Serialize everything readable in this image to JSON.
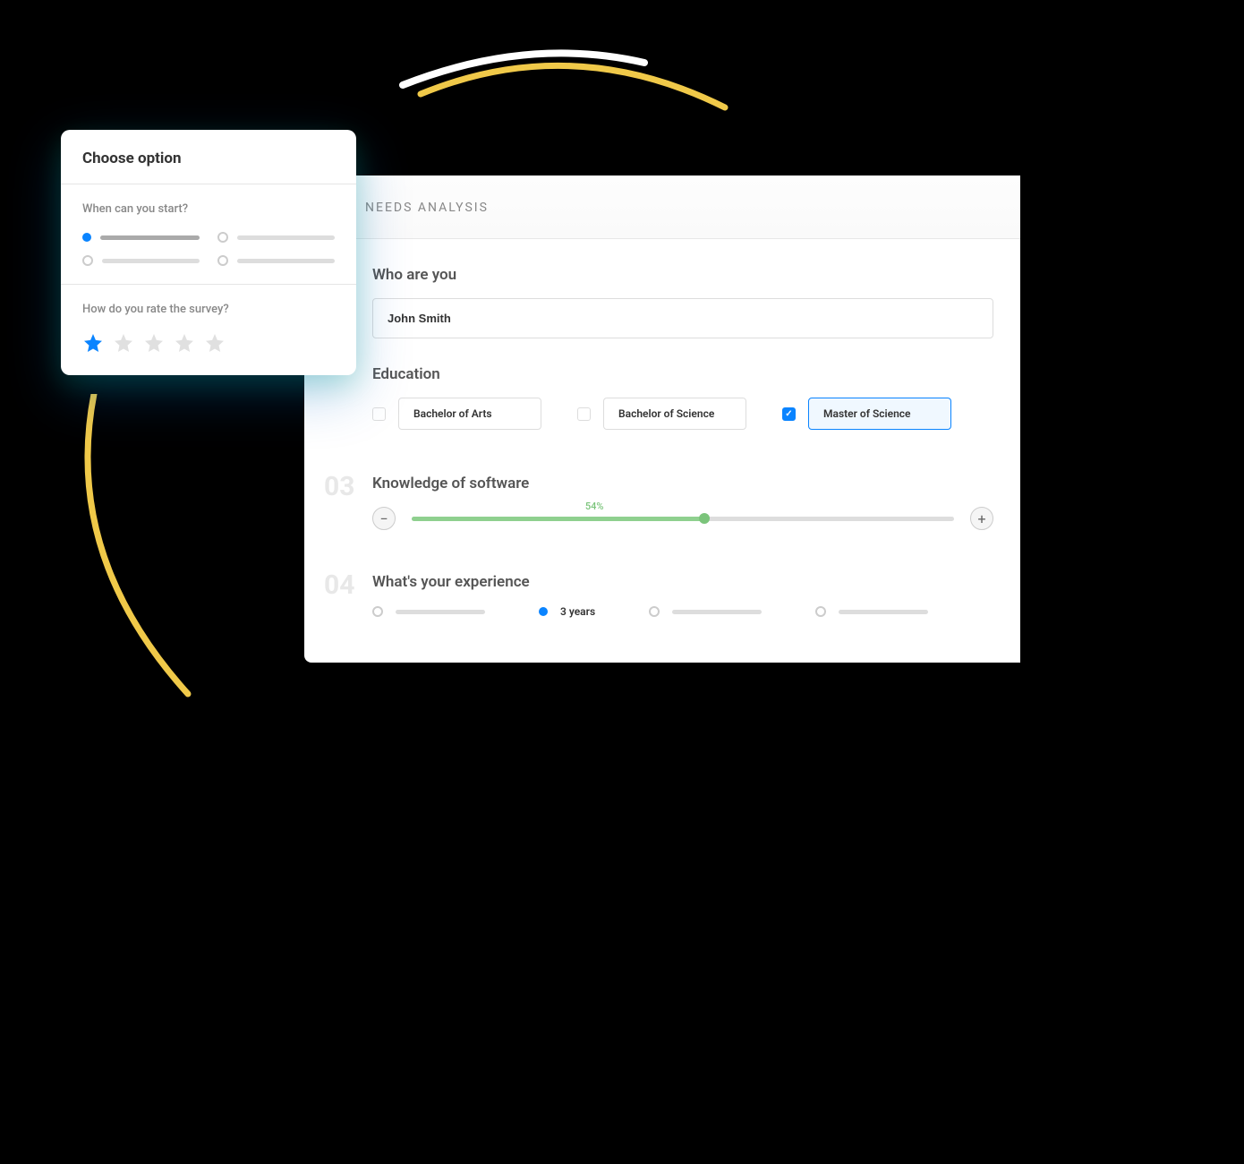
{
  "smallCard": {
    "title": "Choose option",
    "q1": "When can you start?",
    "q2": "How do you rate the survey?",
    "rating": 1
  },
  "largeCard": {
    "title": "NEEDS ANALYSIS",
    "section1": {
      "title": "Who are you",
      "value": "John Smith"
    },
    "section2": {
      "title": "Education",
      "options": [
        {
          "label": "Bachelor of Arts",
          "checked": false
        },
        {
          "label": "Bachelor of Science",
          "checked": false
        },
        {
          "label": "Master of Science",
          "checked": true
        }
      ]
    },
    "section3": {
      "number": "03",
      "title": "Knowledge of software",
      "percent": "54%",
      "value": 54
    },
    "section4": {
      "number": "04",
      "title": "What's your experience",
      "selectedLabel": "3 years"
    }
  },
  "colors": {
    "accent": "#0a84ff",
    "green": "#8fd08f",
    "yellow": "#f0c949"
  }
}
